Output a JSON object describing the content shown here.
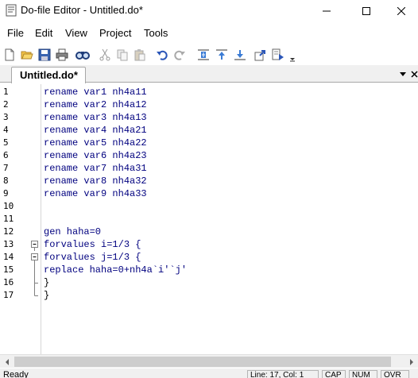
{
  "window": {
    "title": "Do-file Editor - Untitled.do*"
  },
  "menu": [
    "File",
    "Edit",
    "View",
    "Project",
    "Tools"
  ],
  "toolbar": {
    "buttons": [
      "new-file-icon",
      "open-folder-icon",
      "save-icon",
      "print-icon",
      "find-icon",
      "cut-icon",
      "copy-icon",
      "paste-icon",
      "undo-icon",
      "redo-icon",
      "toggle-bookmark-icon",
      "previous-bookmark-icon",
      "next-bookmark-icon",
      "show-file-in-viewer-icon",
      "execute-do-icon"
    ]
  },
  "tabs": [
    {
      "label": "Untitled.do*"
    }
  ],
  "editor": {
    "lines": [
      {
        "num": "1",
        "text": "rename var1 nh4a11",
        "fold": ""
      },
      {
        "num": "2",
        "text": "rename var2 nh4a12",
        "fold": ""
      },
      {
        "num": "3",
        "text": "rename var3 nh4a13",
        "fold": ""
      },
      {
        "num": "4",
        "text": "rename var4 nh4a21",
        "fold": ""
      },
      {
        "num": "5",
        "text": "rename var5 nh4a22",
        "fold": ""
      },
      {
        "num": "6",
        "text": "rename var6 nh4a23",
        "fold": ""
      },
      {
        "num": "7",
        "text": "rename var7 nh4a31",
        "fold": ""
      },
      {
        "num": "8",
        "text": "rename var8 nh4a32",
        "fold": ""
      },
      {
        "num": "9",
        "text": "rename var9 nh4a33",
        "fold": ""
      },
      {
        "num": "10",
        "text": "",
        "fold": ""
      },
      {
        "num": "11",
        "text": "",
        "fold": ""
      },
      {
        "num": "12",
        "text": "gen haha=0",
        "fold": ""
      },
      {
        "num": "13",
        "text": "forvalues i=1/3 {",
        "fold": "open"
      },
      {
        "num": "14",
        "text": "forvalues j=1/3 {",
        "fold": "open"
      },
      {
        "num": "15",
        "text": "replace haha=0+nh4a`i'`j'",
        "fold": "line"
      },
      {
        "num": "16",
        "text": "}",
        "fold": "end"
      },
      {
        "num": "17",
        "text": "}",
        "fold": "end-last"
      }
    ]
  },
  "status": {
    "text": "Ready",
    "position": "Line: 17, Col: 1",
    "caps": "CAP",
    "num": "NUM",
    "ovr": "OVR"
  },
  "colors": {
    "keyword": "#00007f",
    "gutter_border": "#d6d6d6",
    "chrome": "#f0f0f0"
  }
}
